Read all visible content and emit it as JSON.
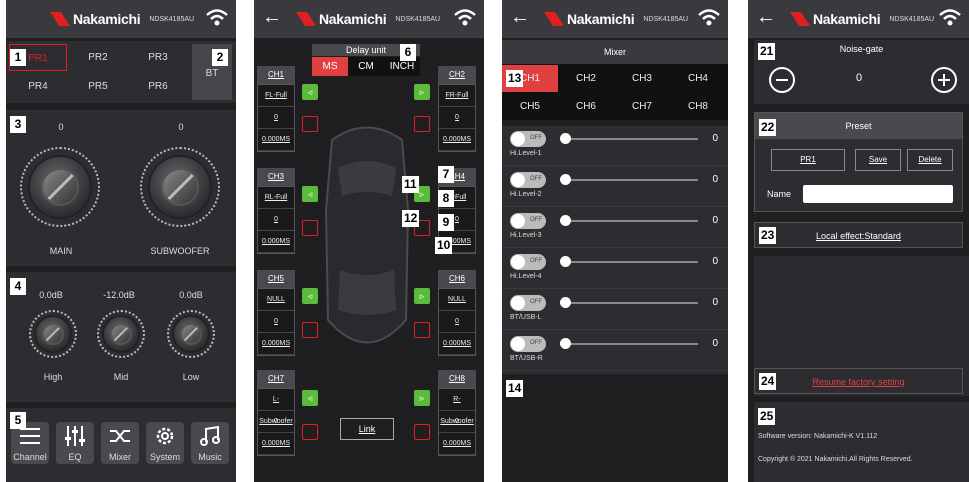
{
  "header": {
    "brand": "Nakamichi",
    "model": "NDSK4185AU"
  },
  "tags": [
    "1",
    "2",
    "3",
    "4",
    "5",
    "6",
    "7",
    "8",
    "9",
    "10",
    "11",
    "12",
    "13",
    "14",
    "21",
    "22",
    "23",
    "24",
    "25"
  ],
  "screen1": {
    "presets": [
      "PR1",
      "PR2",
      "PR3",
      "PR4",
      "PR5",
      "PR6"
    ],
    "bt": "BT",
    "main_value": "0",
    "sub_value": "0",
    "main_label": "MAIN",
    "sub_label": "SUBWOOFER",
    "eq_values": [
      "0.0dB",
      "-12.0dB",
      "0.0dB"
    ],
    "eq_labels": [
      "High",
      "Mid",
      "Low"
    ],
    "nav": [
      "Channel",
      "EQ",
      "Mixer",
      "System",
      "Music"
    ]
  },
  "screen2": {
    "delay_title": "Delay unit",
    "units": [
      "MS",
      "CM",
      "INCH"
    ],
    "left": [
      {
        "ch": "CH1",
        "filter": "FL-Full",
        "val": "0",
        "ms": "0.000MS"
      },
      {
        "ch": "CH3",
        "filter": "RL-Full",
        "val": "0",
        "ms": "0.000MS"
      },
      {
        "ch": "CH5",
        "filter": "NULL",
        "val": "0",
        "ms": "0.000MS"
      },
      {
        "ch": "CH7",
        "filter": "L-Subwoofer",
        "val": "0",
        "ms": "0.000MS"
      }
    ],
    "right": [
      {
        "ch": "CH2",
        "filter": "FR-Full",
        "val": "0",
        "ms": "0.000MS"
      },
      {
        "ch": "CH4",
        "filter": "R-Full",
        "val": "0",
        "ms": "0.000MS"
      },
      {
        "ch": "CH6",
        "filter": "NULL",
        "val": "0",
        "ms": "0.000MS"
      },
      {
        "ch": "CH8",
        "filter": "R-Subwoofer",
        "val": "0",
        "ms": "0.000MS"
      }
    ],
    "link": "Link"
  },
  "screen3": {
    "title": "Mixer",
    "channels": [
      "CH1",
      "CH2",
      "CH3",
      "CH4",
      "CH5",
      "CH6",
      "CH7",
      "CH8"
    ],
    "inputs": [
      {
        "name": "Hi.Level-1",
        "value": "0"
      },
      {
        "name": "Hi.Level-2",
        "value": "0"
      },
      {
        "name": "Hi.Level-3",
        "value": "0"
      },
      {
        "name": "Hi.Level-4",
        "value": "0"
      },
      {
        "name": "BT/USB-L",
        "value": "0"
      },
      {
        "name": "BT/USB-R",
        "value": "0"
      }
    ],
    "toggle": "OFF"
  },
  "screen4": {
    "noise_gate": "Noise-gate",
    "noise_value": "0",
    "preset_title": "Preset",
    "preset_name": "PR1",
    "save": "Save",
    "delete": "Delete",
    "name_label": "Name",
    "local_effect": "Local effect:Standard",
    "resume": "Resume factory setting",
    "version": "Software version: Nakamichi-K V1.112",
    "copyright": "Copyright ® 2021 Nakamichi.All Rights Reserved."
  },
  "colors": {
    "accent": "#e02020",
    "speaker": "#5dbb3c",
    "panel": "#2d2d31"
  }
}
